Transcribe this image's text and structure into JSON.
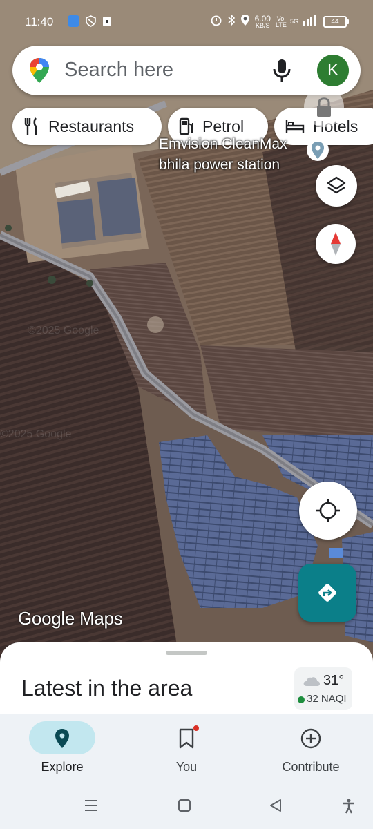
{
  "status_bar": {
    "time": "11:40",
    "net_speed": "6.00",
    "net_unit": "KB/S",
    "volte": "Vo LTE",
    "network": "5G",
    "battery": "44"
  },
  "search": {
    "placeholder": "Search here",
    "avatar_letter": "K"
  },
  "chips": [
    {
      "label": "Restaurants",
      "icon": "fork-knife-icon"
    },
    {
      "label": "Petrol",
      "icon": "fuel-pump-icon"
    },
    {
      "label": "Hotels",
      "icon": "bed-icon"
    }
  ],
  "map": {
    "place_label_line1": "Emvision CleanMax",
    "place_label_line2": "bhila power station",
    "logo": "Google Maps",
    "watermark": "©2025 Google"
  },
  "sheet": {
    "title": "Latest in the area",
    "temperature": "31°",
    "aqi": "32 NAQI"
  },
  "nav": {
    "explore": "Explore",
    "you": "You",
    "contribute": "Contribute"
  },
  "colors": {
    "accent_teal": "#0b7f89",
    "explore_pill": "#c2e7ef",
    "avatar_green": "#2e7d32",
    "aqi_green": "#1e8e3e"
  }
}
